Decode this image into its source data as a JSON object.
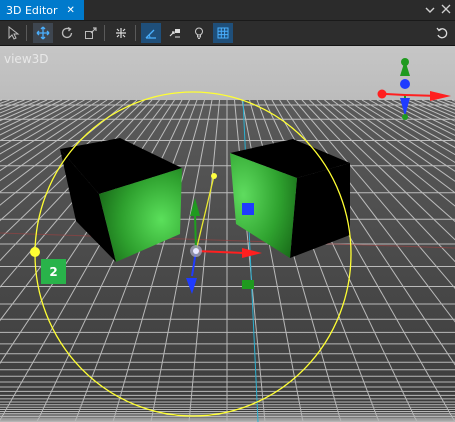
{
  "window": {
    "tab_title": "3D Editor",
    "tab_close_icon": "close-icon",
    "controls": [
      "chevron-down-icon",
      "close-icon"
    ]
  },
  "toolbar": {
    "tools": [
      {
        "name": "select-arrow-icon",
        "state": "normal"
      },
      {
        "name": "move-arrows-icon",
        "state": "active"
      },
      {
        "name": "rotate-icon",
        "state": "normal"
      },
      {
        "name": "scale-icon",
        "state": "normal"
      },
      {
        "name": "focus-cross-icon",
        "state": "normal"
      },
      {
        "name": "snap-angle-icon",
        "state": "toggled"
      },
      {
        "name": "move-to-camera-icon",
        "state": "normal"
      },
      {
        "name": "light-bulb-icon",
        "state": "normal"
      },
      {
        "name": "grid-icon",
        "state": "toggled"
      }
    ],
    "right_tool": "undo-icon"
  },
  "viewport": {
    "label": "view3D",
    "selection_count": "2",
    "colors": {
      "sky": "#c3c3c3",
      "floor": "#4a4a4a",
      "grid_lines": "#e6e6e6",
      "cube_dark": "#000000",
      "cube_face": "#2fae2f",
      "gizmo_circle": "#ffff33",
      "axis_x": "#ff1f1f",
      "axis_y": "#1fa01f",
      "axis_z": "#1f3bff",
      "orient_axis": "#2bb0d0",
      "badge": "#29b34a"
    }
  }
}
